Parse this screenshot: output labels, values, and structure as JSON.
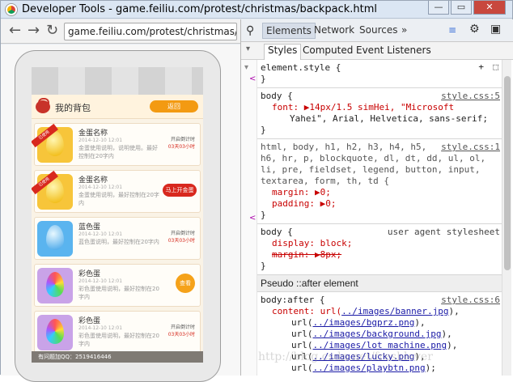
{
  "window": {
    "title": "Developer Tools - game.feiliu.com/protest/christmas/backpack.html"
  },
  "nav": {
    "url": "game.feiliu.com/protest/christmas/backpack.html"
  },
  "app": {
    "header": {
      "title": "我的背包",
      "back_label": "返回"
    },
    "items": [
      {
        "name": "金蛋名称",
        "date": "2014-12-10 12:01",
        "desc": "金蛋使用说明，说明使用。最好控制在20字内",
        "ribbon": "已使用",
        "cd_label": "开启倒计时",
        "cd_time": "03天03小时",
        "action": ""
      },
      {
        "name": "金蛋名称",
        "date": "2014-12-10 12:01",
        "desc": "金蛋使用说明，最好控制在20字内",
        "ribbon": "已使用",
        "cd_label": "",
        "cd_time": "",
        "action": "马上开金蛋"
      },
      {
        "name": "蓝色蛋",
        "date": "2014-12-10 12:01",
        "desc": "蓝色蛋说明，最好控制在20字内",
        "ribbon": "",
        "cd_label": "开启倒计时",
        "cd_time": "03天03小时",
        "action": ""
      },
      {
        "name": "彩色蛋",
        "date": "2014-12-10 12:01",
        "desc": "彩色蛋使用说明，最好控制在20字内",
        "ribbon": "",
        "cd_label": "",
        "cd_time": "",
        "action": "查看"
      },
      {
        "name": "彩色蛋",
        "date": "2014-12-10 12:01",
        "desc": "彩色蛋使用说明，最好控制在20字内",
        "ribbon": "",
        "cd_label": "开启倒计时",
        "cd_time": "03天03小时",
        "action": ""
      }
    ],
    "qq": "有问题加QQ：2519416446"
  },
  "devtools": {
    "tabs": [
      "Elements",
      "Network",
      "Sources"
    ],
    "more": "»",
    "subtabs": [
      "Styles",
      "Computed",
      "Event Listeners"
    ],
    "rules": {
      "r0": {
        "selector": "element.style {",
        "close": "}"
      },
      "r1": {
        "selector": "body {",
        "source": "style.css:5",
        "l1": "font: ▶14px/1.5 simHei, \"Microsoft",
        "l2": "Yahei\", Arial, Helvetica, sans-serif;",
        "close": "}"
      },
      "r2": {
        "source": "style.css:1",
        "sel1": "html, body, h1, h2, h3, h4, h5,",
        "sel2": "h6, hr, p, blockquote, dl, dt, dd, ul, ol,",
        "sel3": "li, pre, fieldset, legend, button, input,",
        "sel4": "textarea, form, th, td {",
        "l1": "margin: ▶0;",
        "l2": "padding: ▶0;",
        "close": "}"
      },
      "r3": {
        "selector": "body {",
        "source": "user agent stylesheet",
        "l1": "display: block;",
        "l2": "margin: ▶8px;",
        "close": "}"
      },
      "pseudo": "Pseudo ::after element",
      "r4": {
        "selector": "body:after {",
        "source": "style.css:6",
        "l0": "content: url(",
        "urls": [
          "../images/banner.jpg",
          "../images/bgprz.png",
          "../images/background.jpg",
          "../images/lot machine.png",
          "../images/lucky.png",
          "../images/playbtn.png"
        ]
      }
    }
  },
  "watermark": "http://blog.csdn.net/freshlover",
  "colors": {
    "accent": "#f39a12",
    "red": "#d8281e",
    "egg_gold": "#f5c400",
    "egg_blue": "#5ab4ef"
  }
}
